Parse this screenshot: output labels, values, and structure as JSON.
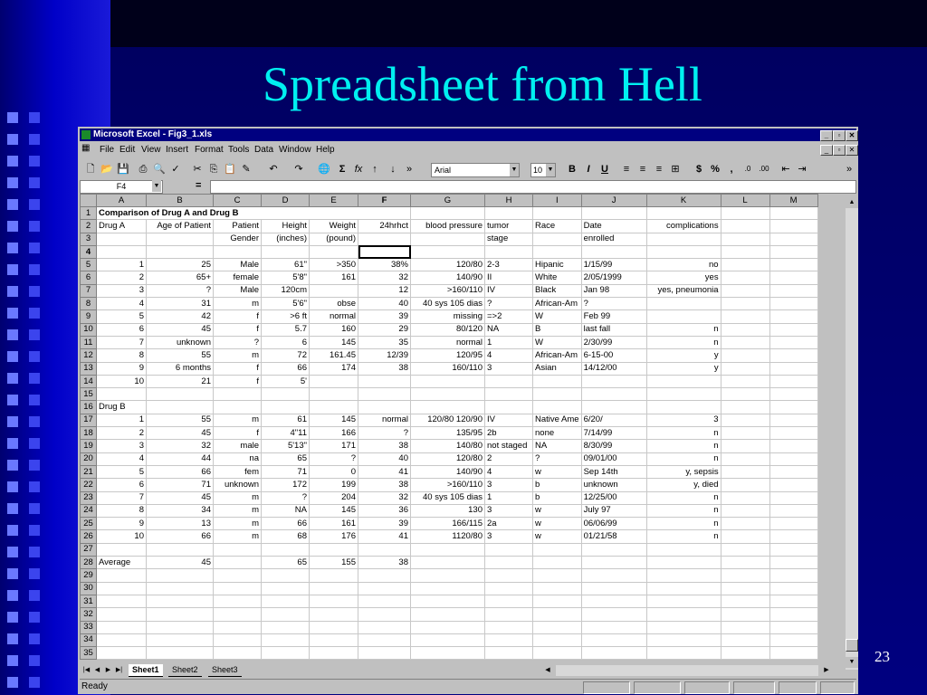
{
  "slide": {
    "title": "Spreadsheet from Hell",
    "number": "23"
  },
  "excel": {
    "app_title": "Microsoft Excel - Fig3_1.xls",
    "menu": [
      "File",
      "Edit",
      "View",
      "Insert",
      "Format",
      "Tools",
      "Data",
      "Window",
      "Help"
    ],
    "font_name": "Arial",
    "font_size": "10",
    "name_box": "F4",
    "formula_eq": "=",
    "formula_value": "",
    "selected_cell": "F4",
    "columns": [
      "A",
      "B",
      "C",
      "D",
      "E",
      "F",
      "G",
      "H",
      "I",
      "J",
      "K",
      "L",
      "M"
    ],
    "rows": [
      {
        "n": "1",
        "cells": [
          "Comparison of Drug A and Drug B",
          "",
          "",
          "",
          "",
          "",
          "",
          "",
          "",
          "",
          "",
          "",
          ""
        ]
      },
      {
        "n": "2",
        "cells": [
          "Drug A",
          "Age of Patient",
          "Patient",
          "Height",
          "Weight",
          "24hrhct",
          "blood pressure",
          "tumor",
          "Race",
          "Date",
          "complications",
          "",
          ""
        ]
      },
      {
        "n": "3",
        "cells": [
          "",
          "",
          "Gender",
          "(inches)",
          "(pound)",
          "",
          "",
          "stage",
          "",
          "enrolled",
          "",
          "",
          ""
        ]
      },
      {
        "n": "4",
        "cells": [
          "",
          "",
          "",
          "",
          "",
          "",
          "",
          "",
          "",
          "",
          "",
          "",
          ""
        ]
      },
      {
        "n": "5",
        "cells": [
          "1",
          "25",
          "Male",
          "61\"",
          ">350",
          "38%",
          "120/80",
          "2-3",
          "Hipanic",
          "1/15/99",
          "no",
          "",
          ""
        ]
      },
      {
        "n": "6",
        "cells": [
          "2",
          "65+",
          "female",
          "5'8\"",
          "161",
          "32",
          "140/90",
          "II",
          "White",
          "2/05/1999",
          "yes",
          "",
          ""
        ]
      },
      {
        "n": "7",
        "cells": [
          "3",
          "?",
          "Male",
          "120cm",
          "",
          "12",
          ">160/110",
          "IV",
          "Black",
          "Jan 98",
          "yes, pneumonia",
          "",
          ""
        ]
      },
      {
        "n": "8",
        "cells": [
          "4",
          "31",
          "m",
          "5'6\"",
          "obse",
          "40",
          "40 sys 105 dias",
          "?",
          "African-Am",
          "?",
          "",
          "",
          ""
        ]
      },
      {
        "n": "9",
        "cells": [
          "5",
          "42",
          "f",
          ">6 ft",
          "normal",
          "39",
          "missing",
          "=>2",
          "W",
          "Feb 99",
          "",
          "",
          ""
        ]
      },
      {
        "n": "10",
        "cells": [
          "6",
          "45",
          "f",
          "5.7",
          "160",
          "29",
          "80/120",
          "NA",
          "B",
          "last fall",
          "n",
          "",
          ""
        ]
      },
      {
        "n": "11",
        "cells": [
          "7",
          "unknown",
          "?",
          "6",
          "145",
          "35",
          "normal",
          "1",
          "W",
          "2/30/99",
          "n",
          "",
          ""
        ]
      },
      {
        "n": "12",
        "cells": [
          "8",
          "55",
          "m",
          "72",
          "161.45",
          "12/39",
          "120/95",
          "4",
          "African-Am",
          "6-15-00",
          "y",
          "",
          ""
        ]
      },
      {
        "n": "13",
        "cells": [
          "9",
          "6 months",
          "f",
          "66",
          "174",
          "38",
          "160/110",
          "3",
          "Asian",
          "14/12/00",
          "y",
          "",
          ""
        ]
      },
      {
        "n": "14",
        "cells": [
          "10",
          "21",
          "f",
          "5'",
          "",
          "",
          "",
          "",
          "",
          "",
          "",
          "",
          ""
        ]
      },
      {
        "n": "15",
        "cells": [
          "",
          "",
          "",
          "",
          "",
          "",
          "",
          "",
          "",
          "",
          "",
          "",
          ""
        ]
      },
      {
        "n": "16",
        "cells": [
          "Drug B",
          "",
          "",
          "",
          "",
          "",
          "",
          "",
          "",
          "",
          "",
          "",
          ""
        ]
      },
      {
        "n": "17",
        "cells": [
          "1",
          "55",
          "m",
          "61",
          "145",
          "normal",
          "120/80 120/90",
          "IV",
          "Native Ame",
          "6/20/",
          "3",
          "",
          ""
        ]
      },
      {
        "n": "18",
        "cells": [
          "2",
          "45",
          "f",
          "4\"11",
          "166",
          "?",
          "135/95",
          "2b",
          "none",
          "7/14/99",
          "n",
          "",
          ""
        ]
      },
      {
        "n": "19",
        "cells": [
          "3",
          "32",
          "male",
          "5'13\"",
          "171",
          "38",
          "140/80",
          "not staged",
          "NA",
          "8/30/99",
          "n",
          "",
          ""
        ]
      },
      {
        "n": "20",
        "cells": [
          "4",
          "44",
          "na",
          "65",
          "?",
          "40",
          "120/80",
          "2",
          "?",
          "09/01/00",
          "n",
          "",
          ""
        ]
      },
      {
        "n": "21",
        "cells": [
          "5",
          "66",
          "fem",
          "71",
          "0",
          "41",
          "140/90",
          "4",
          "w",
          "Sep 14th",
          "y, sepsis",
          "",
          ""
        ]
      },
      {
        "n": "22",
        "cells": [
          "6",
          "71",
          "unknown",
          "172",
          "199",
          "38",
          ">160/110",
          "3",
          "b",
          "unknown",
          "y, died",
          "",
          ""
        ]
      },
      {
        "n": "23",
        "cells": [
          "7",
          "45",
          "m",
          "?",
          "204",
          "32",
          "40 sys 105 dias",
          "1",
          "b",
          "12/25/00",
          "n",
          "",
          ""
        ]
      },
      {
        "n": "24",
        "cells": [
          "8",
          "34",
          "m",
          "NA",
          "145",
          "36",
          "130",
          "3",
          "w",
          "July 97",
          "n",
          "",
          ""
        ]
      },
      {
        "n": "25",
        "cells": [
          "9",
          "13",
          "m",
          "66",
          "161",
          "39",
          "166/115",
          "2a",
          "w",
          "06/06/99",
          "n",
          "",
          ""
        ]
      },
      {
        "n": "26",
        "cells": [
          "10",
          "66",
          "m",
          "68",
          "176",
          "41",
          "1120/80",
          "3",
          "w",
          "01/21/58",
          "n",
          "",
          ""
        ]
      },
      {
        "n": "27",
        "cells": [
          "",
          "",
          "",
          "",
          "",
          "",
          "",
          "",
          "",
          "",
          "",
          "",
          ""
        ]
      },
      {
        "n": "28",
        "cells": [
          "Average",
          "45",
          "",
          "65",
          "155",
          "38",
          "",
          "",
          "",
          "",
          "",
          "",
          ""
        ]
      },
      {
        "n": "29",
        "cells": [
          "",
          "",
          "",
          "",
          "",
          "",
          "",
          "",
          "",
          "",
          "",
          "",
          ""
        ]
      },
      {
        "n": "30",
        "cells": [
          "",
          "",
          "",
          "",
          "",
          "",
          "",
          "",
          "",
          "",
          "",
          "",
          ""
        ]
      },
      {
        "n": "31",
        "cells": [
          "",
          "",
          "",
          "",
          "",
          "",
          "",
          "",
          "",
          "",
          "",
          "",
          ""
        ]
      },
      {
        "n": "32",
        "cells": [
          "",
          "",
          "",
          "",
          "",
          "",
          "",
          "",
          "",
          "",
          "",
          "",
          ""
        ]
      },
      {
        "n": "33",
        "cells": [
          "",
          "",
          "",
          "",
          "",
          "",
          "",
          "",
          "",
          "",
          "",
          "",
          ""
        ]
      },
      {
        "n": "34",
        "cells": [
          "",
          "",
          "",
          "",
          "",
          "",
          "",
          "",
          "",
          "",
          "",
          "",
          ""
        ]
      },
      {
        "n": "35",
        "cells": [
          "",
          "",
          "",
          "",
          "",
          "",
          "",
          "",
          "",
          "",
          "",
          "",
          ""
        ]
      }
    ],
    "sheet_tabs": [
      "Sheet1",
      "Sheet2",
      "Sheet3"
    ],
    "active_sheet": "Sheet1",
    "status": "Ready"
  }
}
